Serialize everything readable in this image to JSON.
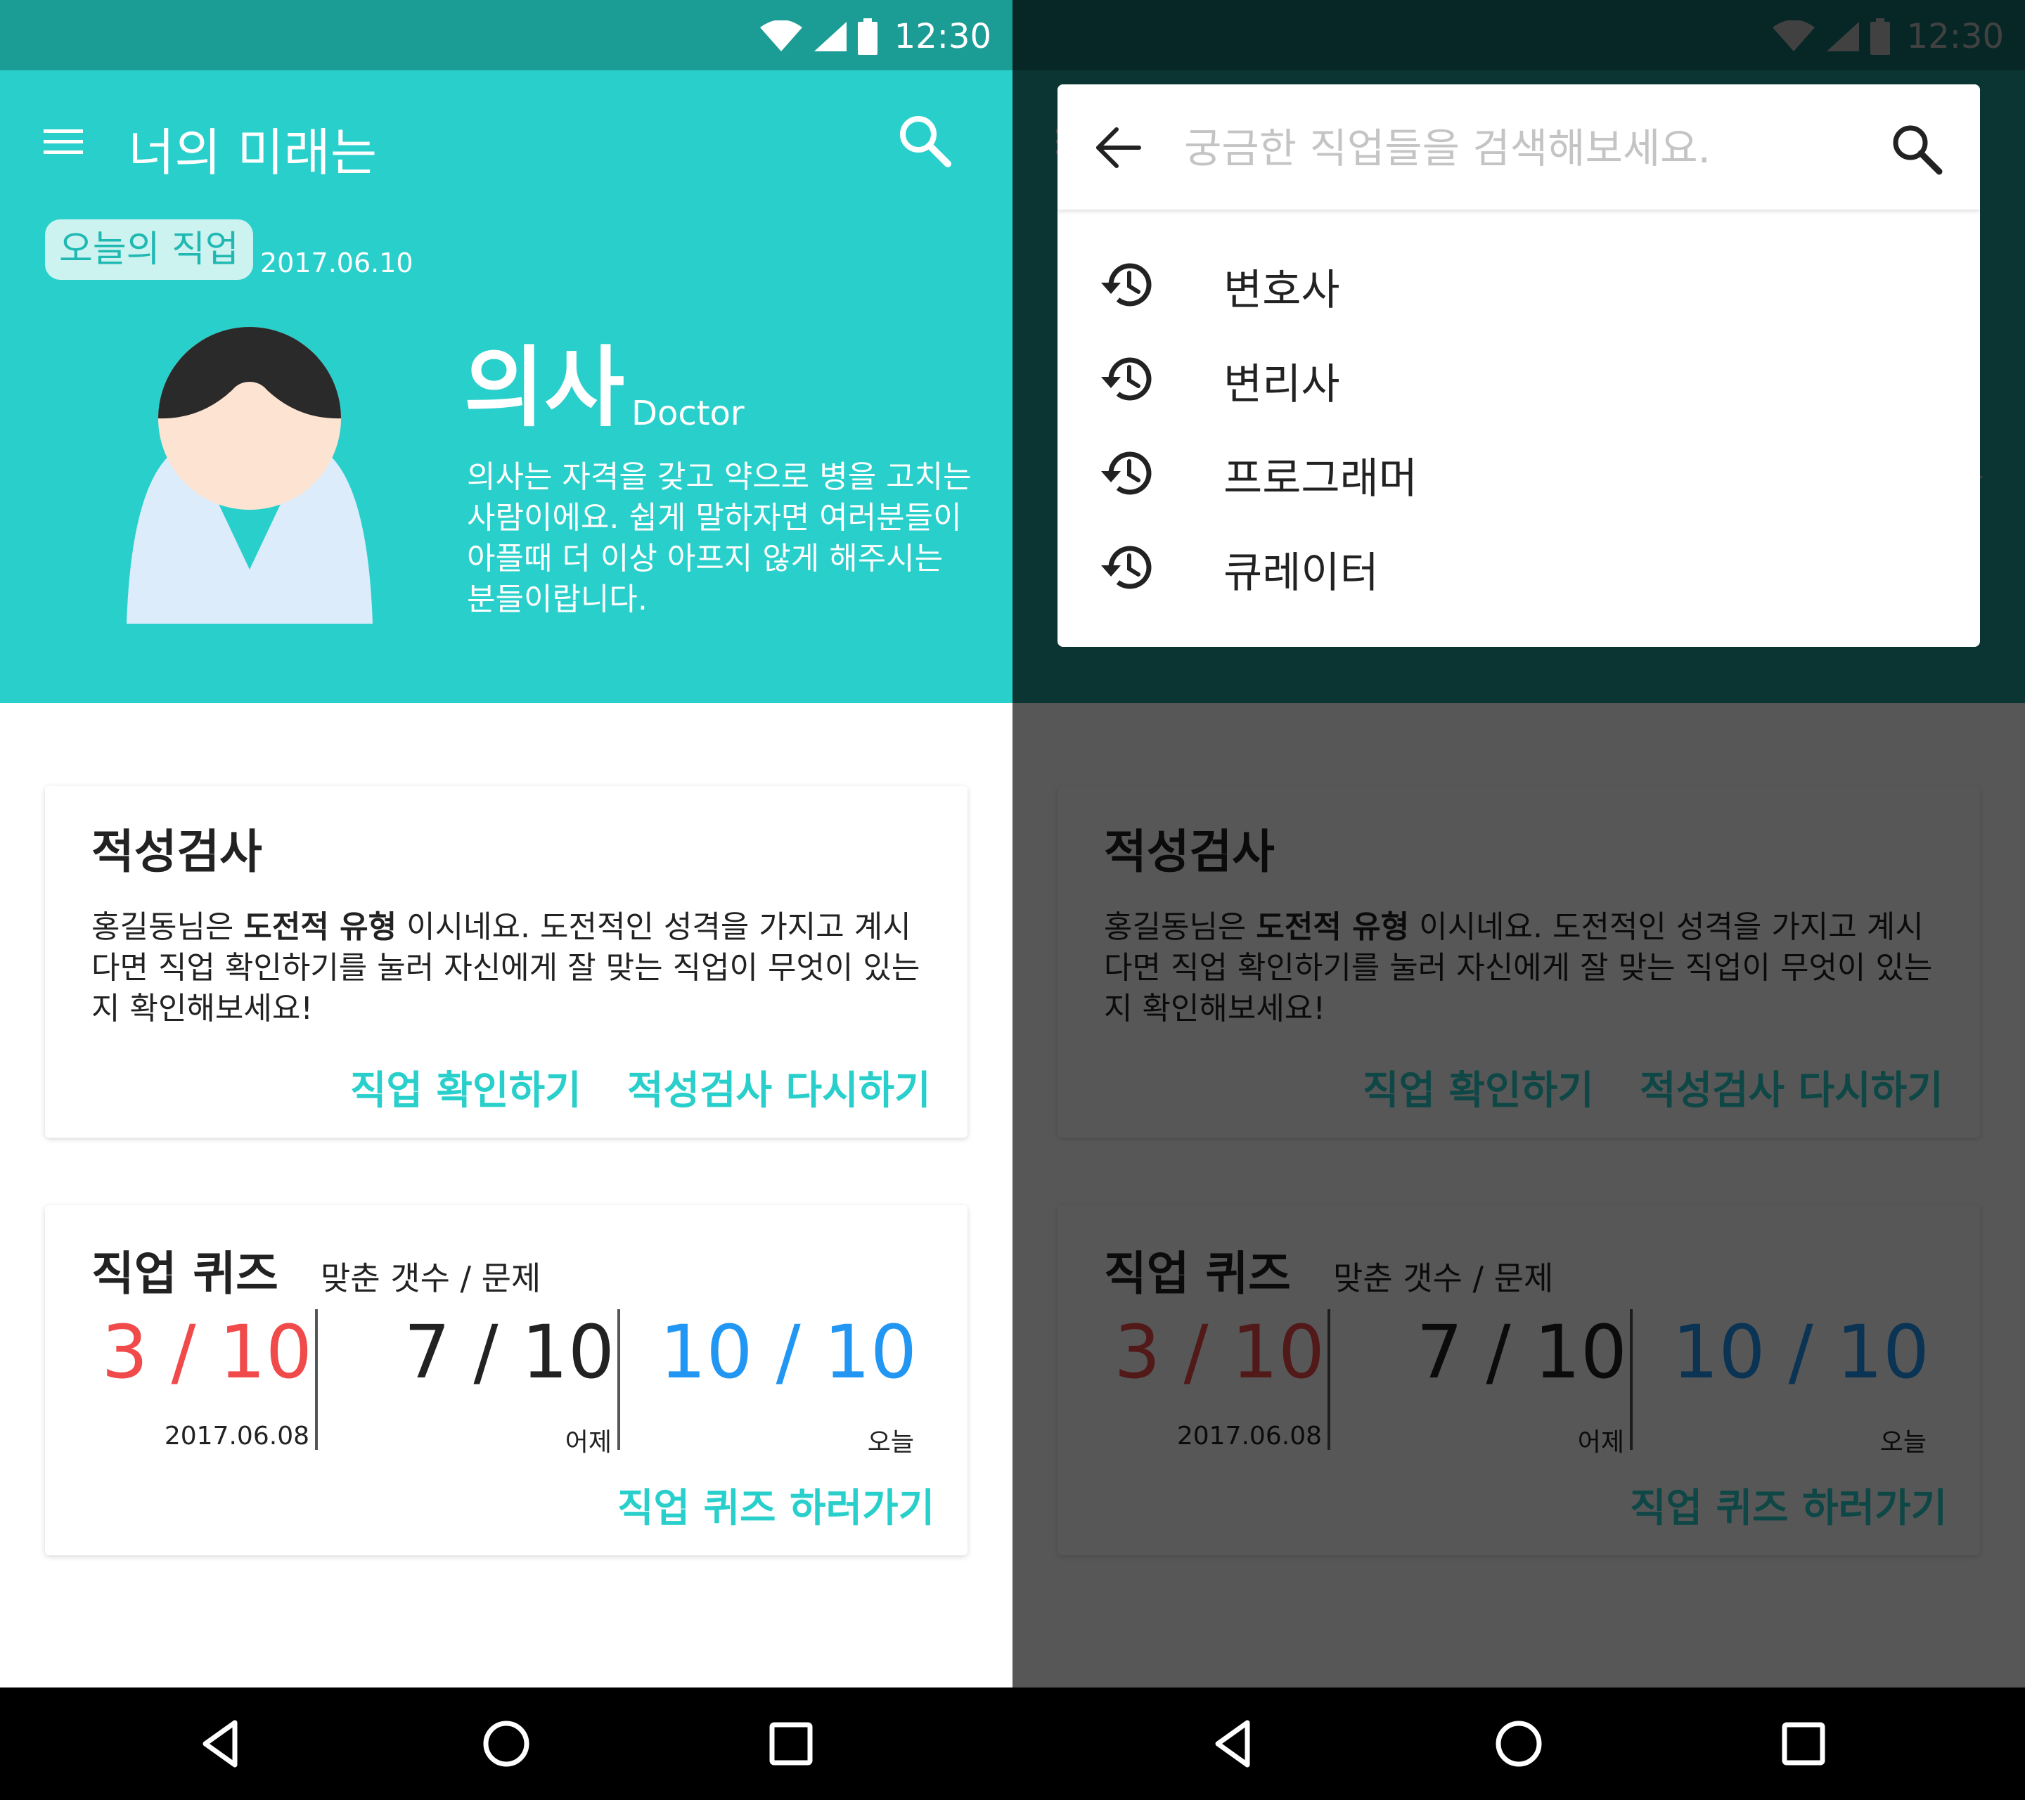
{
  "status_bar": {
    "time": "12:30"
  },
  "app_bar": {
    "title": "너의 미래는"
  },
  "today_job": {
    "badge": "오늘의 직업",
    "date": "2017.06.10",
    "title": "의사",
    "title_en": "Doctor",
    "description": "의사는 자격을 갖고 약으로 병을 고치는 사람이에요. 쉽게 말하자면 여러분들이 아플때 더 이상 아프지 않게 해주시는 분들이랍니다."
  },
  "aptitude": {
    "title": "적성검사",
    "body_prefix": "홍길동님은 ",
    "body_bold": "도전적 유형",
    "body_suffix": " 이시네요. 도전적인 성격을 가지고 계시다면 직업 확인하기를 눌러 자신에게 잘 맞는 직업이 무엇이 있는지 확인해보세요!",
    "action_check": "직업 확인하기",
    "action_retry": "적성검사 다시하기"
  },
  "quiz": {
    "title": "직업 퀴즈",
    "subtitle": "맞춘 갯수 / 문제",
    "scores": [
      {
        "score": "3 / 10",
        "label": "2017.06.08",
        "color": "#f04a4a"
      },
      {
        "score": "7 / 10",
        "label": "어제",
        "color": "#222222"
      },
      {
        "score": "10 / 10",
        "label": "오늘",
        "color": "#2196f3"
      }
    ],
    "action": "직업 퀴즈 하러가기"
  },
  "search": {
    "placeholder": "궁금한 직업들을 검색해보세요.",
    "recent": [
      "변호사",
      "변리사",
      "프로그래머",
      "큐레이터"
    ]
  },
  "icons": {
    "menu": "menu-icon",
    "search": "search-icon",
    "back": "arrow-back-icon",
    "history": "history-icon",
    "nav_back": "nav-back-icon",
    "nav_home": "nav-home-icon",
    "nav_recent": "nav-recent-icon",
    "wifi": "wifi-icon",
    "signal": "signal-icon",
    "battery": "battery-icon"
  },
  "colors": {
    "primary": "#29cfcb",
    "status_bar": "#1b9c95",
    "score_low": "#f04a4a",
    "score_high": "#2196f3"
  }
}
